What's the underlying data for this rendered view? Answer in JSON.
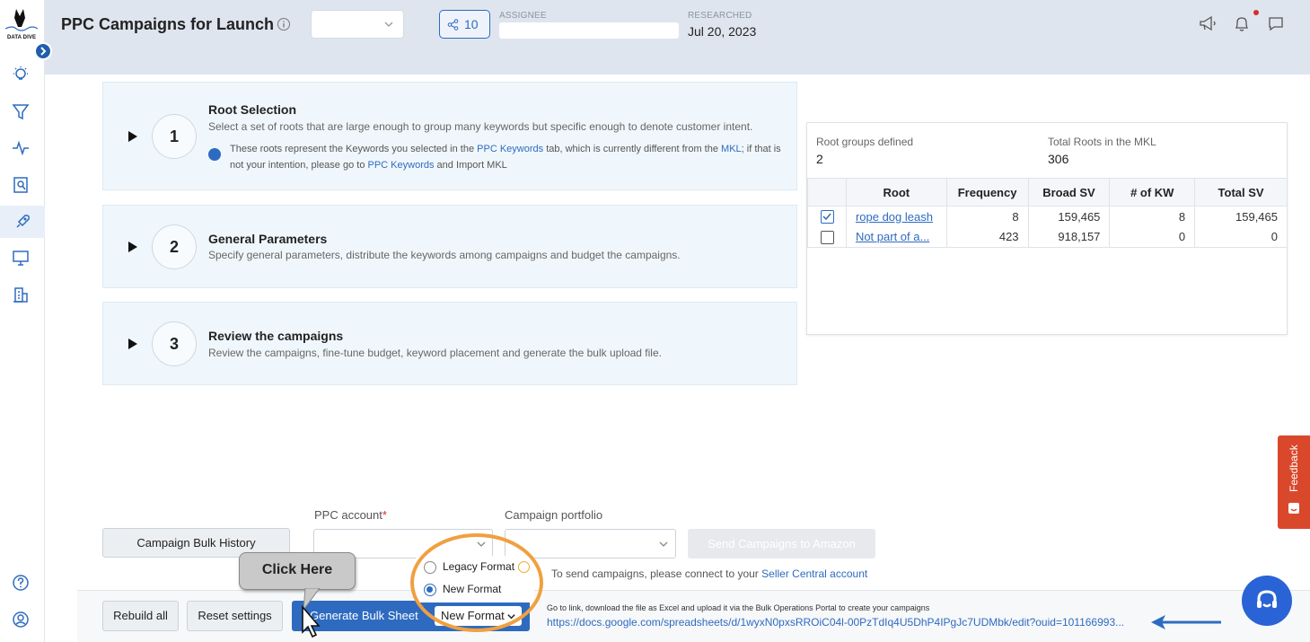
{
  "sidebar": {
    "logo_text": "DATA DIVE",
    "items": [
      {
        "name": "lightbulb-icon"
      },
      {
        "name": "funnel-icon"
      },
      {
        "name": "pulse-icon"
      },
      {
        "name": "search-document-icon"
      },
      {
        "name": "rocket-icon",
        "active": true
      },
      {
        "name": "monitor-icon"
      },
      {
        "name": "building-icon"
      }
    ],
    "bottom": [
      {
        "name": "help-icon"
      },
      {
        "name": "user-icon"
      }
    ]
  },
  "header": {
    "title": "PPC Campaigns for Launch",
    "share_count": "10",
    "assignee_label": "ASSIGNEE",
    "researched_label": "RESEARCHED",
    "researched_value": "Jul 20, 2023"
  },
  "steps": [
    {
      "number": "1",
      "title": "Root Selection",
      "description": "Select a set of roots that are large enough to group many keywords but specific enough to denote customer intent.",
      "note": {
        "p1": "These roots represent the Keywords you selected in the ",
        "link1": "PPC Keywords",
        "p2": "  tab, which is currently different from the ",
        "link2": "MKL",
        "p3": "; if that is not your intention, please go to ",
        "link3": "PPC Keywords",
        "p4": " and Import MKL"
      }
    },
    {
      "number": "2",
      "title": "General Parameters",
      "description": "Specify general parameters, distribute the keywords among campaigns and budget the campaigns."
    },
    {
      "number": "3",
      "title": "Review the campaigns",
      "description": "Review the campaigns, fine-tune budget, keyword placement and generate the bulk upload file."
    }
  ],
  "roots_panel": {
    "groups_label": "Root groups defined",
    "groups_value": "2",
    "total_label": "Total Roots in the MKL",
    "total_value": "306",
    "columns": [
      "Root",
      "Frequency",
      "Broad SV",
      "# of KW",
      "Total SV"
    ],
    "rows": [
      {
        "checked": true,
        "root": "rope dog leash",
        "frequency": "8",
        "broad_sv": "159,465",
        "kw": "8",
        "total_sv": "159,465"
      },
      {
        "checked": false,
        "root": "Not part of a...",
        "frequency": "423",
        "broad_sv": "918,157",
        "kw": "0",
        "total_sv": "0"
      }
    ]
  },
  "controls": {
    "ppc_account_label": "PPC account",
    "ppc_required": "*",
    "portfolio_label": "Campaign portfolio",
    "bulk_history": "Campaign Bulk History",
    "send_to_amazon": "Send Campaigns to Amazon",
    "connect_text": "To send campaigns, please connect to your ",
    "connect_link": "Seller Central account",
    "rebuild_all": "Rebuild all",
    "reset_settings": "Reset settings",
    "generate": "Generate Bulk Sheet",
    "format_selected": "New Format",
    "format_options": [
      "Legacy Format",
      "New Format"
    ],
    "link_caption": "Go to link, download the file as Excel and upload it via the Bulk Operations Portal to create your campaigns",
    "sheet_link": "https://docs.google.com/spreadsheets/d/1wyxN0pxsRROiC04l-00PzTdIq4U5DhP4IPgJc7UDMbk/edit?ouid=101166993..."
  },
  "annotation": {
    "callout": "Click Here"
  },
  "feedback_label": "Feedback",
  "colors": {
    "primary": "#2e6bc0",
    "header_bg": "#dfe5ee",
    "step_bg": "#f0f7fc",
    "highlight_ring": "#f0a040",
    "feedback": "#d9482b"
  }
}
